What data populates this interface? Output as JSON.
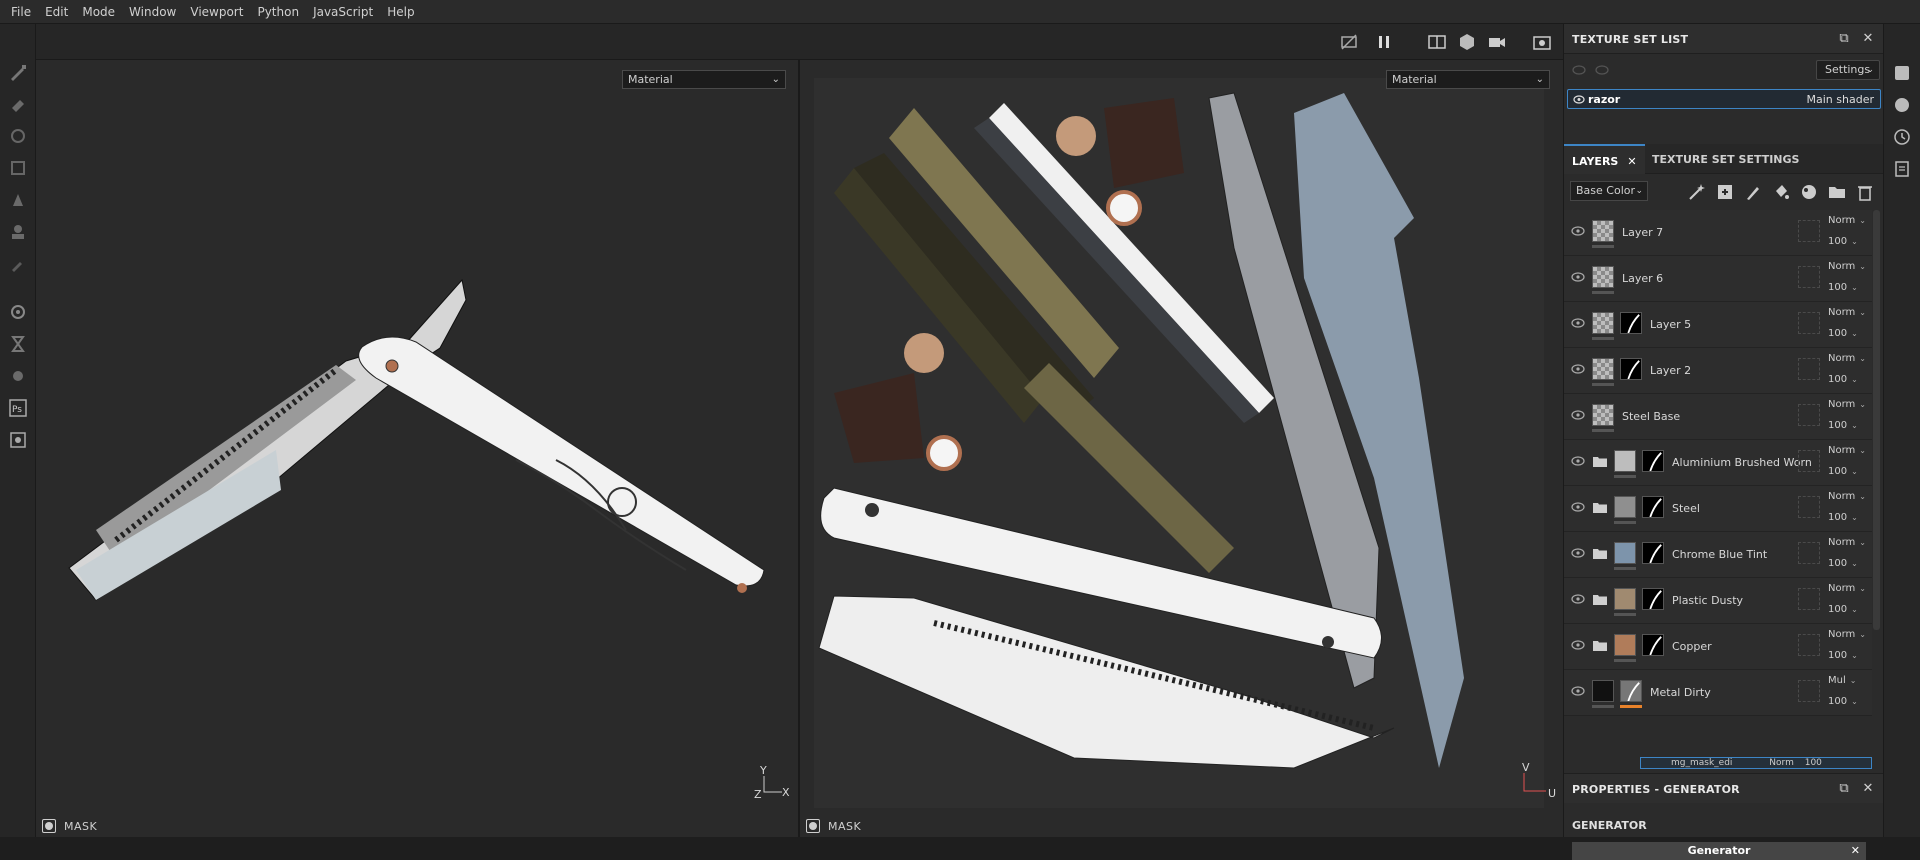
{
  "menu": [
    "File",
    "Edit",
    "Mode",
    "Window",
    "Viewport",
    "Python",
    "JavaScript",
    "Help"
  ],
  "viewport_left": {
    "mode": "Material",
    "footer": "MASK",
    "axis_y": "Y",
    "axis_x": "X",
    "axis_z": "Z"
  },
  "viewport_right": {
    "mode": "Material",
    "footer": "MASK",
    "axis_v": "V",
    "axis_u": "U"
  },
  "texture_set_list": {
    "title": "TEXTURE SET LIST",
    "settings_label": "Settings",
    "items": [
      {
        "name": "razor",
        "shader": "Main shader"
      }
    ]
  },
  "tabs": {
    "layers": "LAYERS",
    "texture_set_settings": "TEXTURE SET SETTINGS"
  },
  "channel": "Base Color",
  "layers": [
    {
      "name": "Layer 7",
      "blend": "Norm",
      "opacity": "100"
    },
    {
      "name": "Layer 6",
      "blend": "Norm",
      "opacity": "100"
    },
    {
      "name": "Layer 5",
      "blend": "Norm",
      "opacity": "100"
    },
    {
      "name": "Layer 2",
      "blend": "Norm",
      "opacity": "100"
    },
    {
      "name": "Steel Base",
      "blend": "Norm",
      "opacity": "100"
    },
    {
      "name": "Aluminium Brushed Worn",
      "blend": "Norm",
      "opacity": "100"
    },
    {
      "name": "Steel",
      "blend": "Norm",
      "opacity": "100"
    },
    {
      "name": "Chrome Blue Tint",
      "blend": "Norm",
      "opacity": "100"
    },
    {
      "name": "Plastic Dusty",
      "blend": "Norm",
      "opacity": "100"
    },
    {
      "name": "Copper",
      "blend": "Norm",
      "opacity": "100"
    },
    {
      "name": "Metal Dirty",
      "blend": "Mul",
      "opacity": "100"
    }
  ],
  "sub_layer": {
    "name": "mg_mask_edi",
    "blend": "Norm",
    "opacity": "100"
  },
  "properties": {
    "title": "PROPERTIES - GENERATOR",
    "section": "GENERATOR",
    "generator_label": "Generator"
  },
  "colors": {
    "accent": "#3d85c6",
    "panel": "#2b2b2b",
    "viewport": "#2a2a2a",
    "orange_indicator": "#e8822a"
  }
}
